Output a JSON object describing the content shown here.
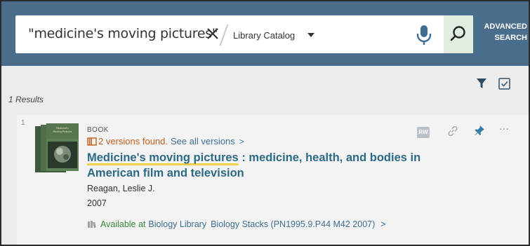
{
  "search": {
    "query": "\"medicine's moving pictures\"",
    "scope": "Library Catalog",
    "advanced_line1": "ADVANCED",
    "advanced_line2": "SEARCH"
  },
  "results": {
    "count_label": "1 Results"
  },
  "result": {
    "number": "1",
    "type": "BOOK",
    "versions_found": "2 versions found.",
    "see_all": "See all versions",
    "see_all_caret": ">",
    "title_main": "Medicine's moving pictures",
    "title_rest": " : medicine, health, and bodies in American film and television",
    "author": "Reagan, Leslie J.",
    "year": "2007",
    "availability_status": "Available at",
    "availability_library": "Biology Library",
    "availability_location": "Biology Stacks (PN1995.9.P44 M42 2007)",
    "availability_caret": ">",
    "rw_badge": "RW",
    "more": "···"
  },
  "cover": {
    "title_line1": "Medicine's",
    "title_line2": "Moving Pictures"
  },
  "colors": {
    "header_bg": "#4b6d8c",
    "accent_title": "#2c6a86",
    "versions_orange": "#c35d1a",
    "available_green": "#3a8a3a",
    "highlight_yellow": "#f5d04a"
  },
  "icons": [
    "clear-icon",
    "microphone-icon",
    "search-icon",
    "filter-icon",
    "select-all-icon",
    "versions-icon",
    "availability-icon",
    "link-icon",
    "pin-icon",
    "more-icon"
  ]
}
